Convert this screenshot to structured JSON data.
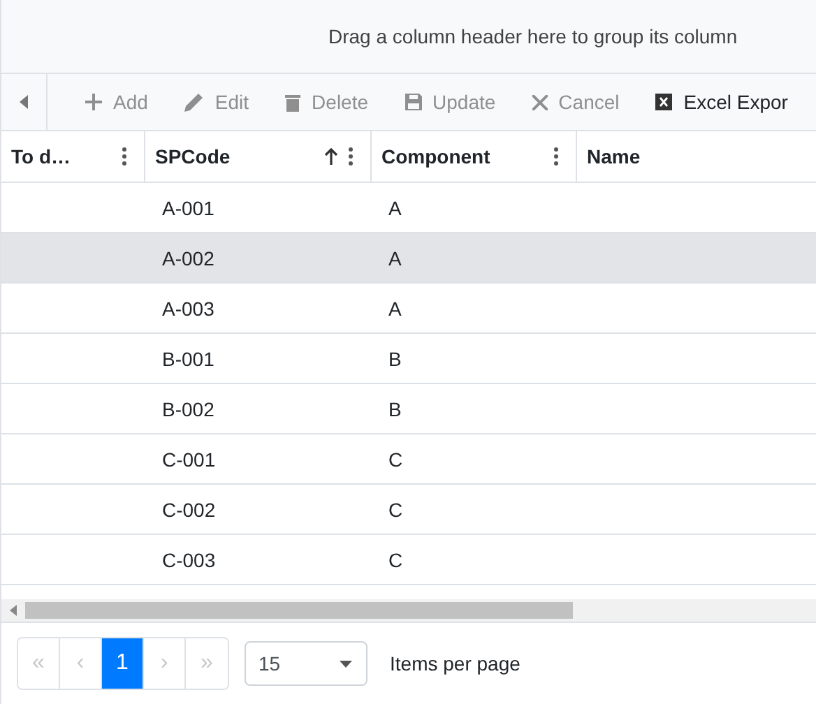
{
  "group_panel": {
    "placeholder": "Drag a column header here to group its column"
  },
  "toolbar": [
    {
      "kind": "add",
      "label": "Add",
      "disabled": true
    },
    {
      "kind": "edit",
      "label": "Edit",
      "disabled": true
    },
    {
      "kind": "delete",
      "label": "Delete",
      "disabled": true
    },
    {
      "kind": "update",
      "label": "Update",
      "disabled": true
    },
    {
      "kind": "cancel",
      "label": "Cancel",
      "disabled": true
    },
    {
      "kind": "excel",
      "label": "Excel Expor",
      "disabled": false
    }
  ],
  "table": {
    "columns": [
      {
        "label": "To d…",
        "sorted": false,
        "menu": true
      },
      {
        "label": "SPCode",
        "sorted": true,
        "menu": true
      },
      {
        "label": "Component",
        "sorted": false,
        "menu": true
      },
      {
        "label": "Name",
        "sorted": false,
        "menu": false
      }
    ],
    "rows": [
      {
        "cells": [
          "",
          "A-001",
          "A",
          ""
        ],
        "hovered": false
      },
      {
        "cells": [
          "",
          "A-002",
          "A",
          ""
        ],
        "hovered": true
      },
      {
        "cells": [
          "",
          "A-003",
          "A",
          ""
        ],
        "hovered": false
      },
      {
        "cells": [
          "",
          "B-001",
          "B",
          ""
        ],
        "hovered": false
      },
      {
        "cells": [
          "",
          "B-002",
          "B",
          ""
        ],
        "hovered": false
      },
      {
        "cells": [
          "",
          "C-001",
          "C",
          ""
        ],
        "hovered": false
      },
      {
        "cells": [
          "",
          "C-002",
          "C",
          ""
        ],
        "hovered": false
      },
      {
        "cells": [
          "",
          "C-003",
          "C",
          ""
        ],
        "hovered": false
      }
    ]
  },
  "pager": {
    "buttons": [
      {
        "label": "«",
        "selected": false,
        "disabled": true
      },
      {
        "label": "‹",
        "selected": false,
        "disabled": true
      },
      {
        "label": "1",
        "selected": true,
        "disabled": false
      },
      {
        "label": "›",
        "selected": false,
        "disabled": true
      },
      {
        "label": "»",
        "selected": false,
        "disabled": true
      }
    ],
    "page_size": "15",
    "page_size_label": "Items per page"
  }
}
